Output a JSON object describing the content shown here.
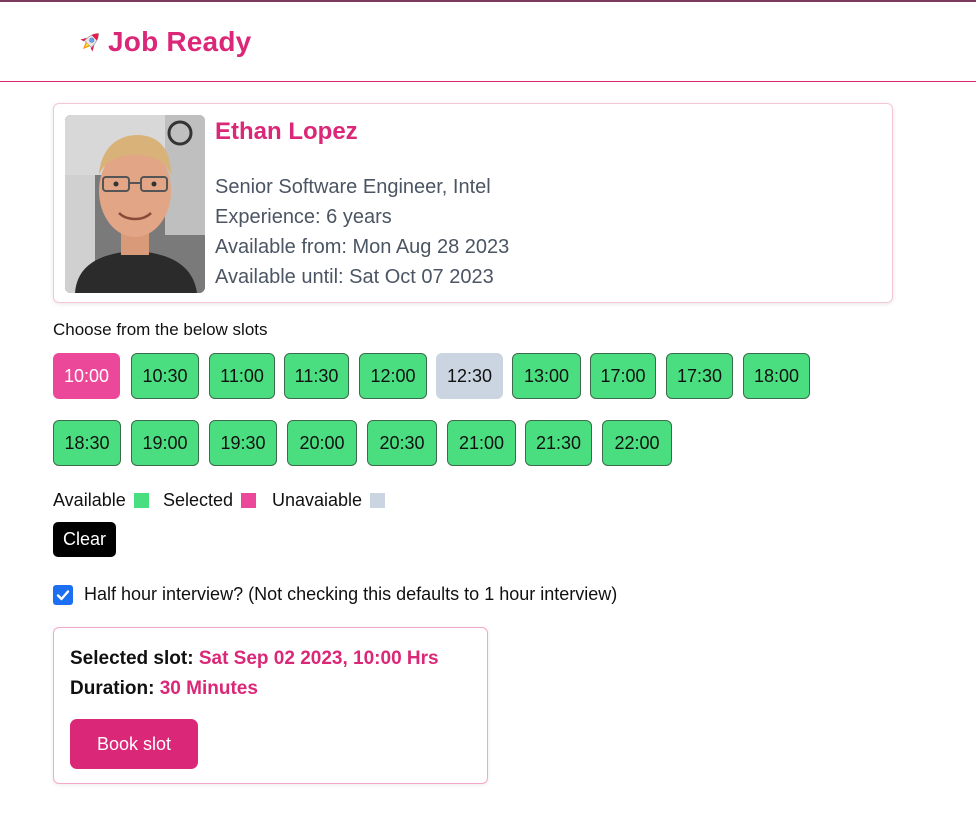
{
  "header": {
    "title": "Job Ready",
    "logo_icon": "rocket-icon"
  },
  "profile": {
    "name": "Ethan Lopez",
    "role": "Senior Software Engineer, Intel",
    "experience": "Experience: 6 years",
    "available_from": "Available from: Mon Aug 28 2023",
    "available_until": "Available until: Sat Oct 07 2023"
  },
  "slots": {
    "heading": "Choose from the below slots",
    "items": [
      {
        "time": "10:00",
        "state": "selected"
      },
      {
        "time": "10:30",
        "state": "available"
      },
      {
        "time": "11:00",
        "state": "available"
      },
      {
        "time": "11:30",
        "state": "available"
      },
      {
        "time": "12:00",
        "state": "available"
      },
      {
        "time": "12:30",
        "state": "unavailable"
      },
      {
        "time": "13:00",
        "state": "available"
      },
      {
        "time": "17:00",
        "state": "available"
      },
      {
        "time": "17:30",
        "state": "available"
      },
      {
        "time": "18:00",
        "state": "available"
      },
      {
        "time": "18:30",
        "state": "available"
      },
      {
        "time": "19:00",
        "state": "available"
      },
      {
        "time": "19:30",
        "state": "available"
      },
      {
        "time": "20:00",
        "state": "available"
      },
      {
        "time": "20:30",
        "state": "available"
      },
      {
        "time": "21:00",
        "state": "available"
      },
      {
        "time": "21:30",
        "state": "available"
      },
      {
        "time": "22:00",
        "state": "available"
      }
    ]
  },
  "legend": {
    "available": "Available",
    "selected": "Selected",
    "unavailable": "Unavaiable"
  },
  "colors": {
    "brand": "#db2777",
    "available": "#4ade80",
    "selected": "#ec4899",
    "unavailable": "#cbd5e1"
  },
  "clear_label": "Clear",
  "half_hour": {
    "label": "Half hour interview? (Not checking this defaults to 1 hour interview)",
    "checked": true
  },
  "summary": {
    "slot_label": "Selected slot:",
    "slot_value": "Sat Sep 02 2023, 10:00 Hrs",
    "duration_label": "Duration:",
    "duration_value": "30 Minutes",
    "book_label": "Book slot"
  }
}
